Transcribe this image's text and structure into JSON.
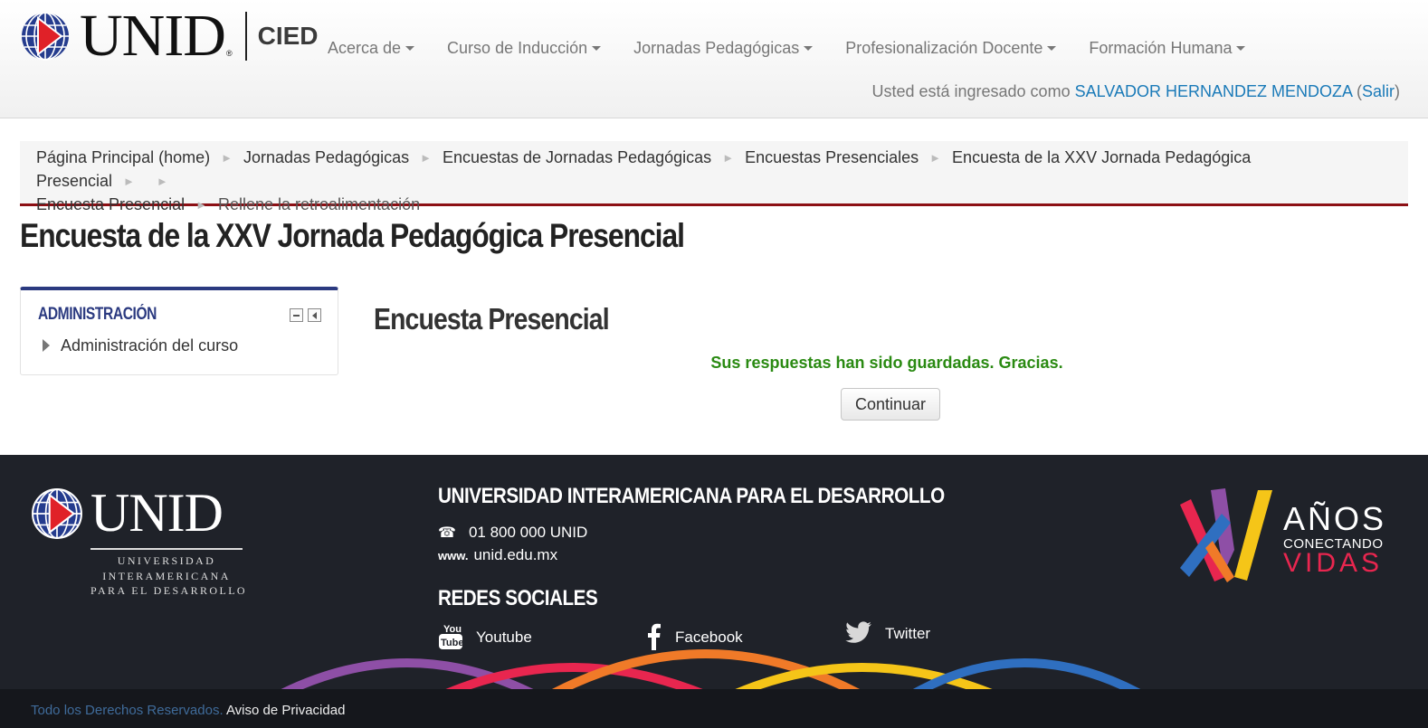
{
  "header": {
    "logo_text": "UNID",
    "logo_sub": "CIED",
    "nav": [
      {
        "label": "Acerca de"
      },
      {
        "label": "Curso de Inducción"
      },
      {
        "label": "Jornadas Pedagógicas"
      },
      {
        "label": "Profesionalización Docente"
      },
      {
        "label": "Formación Humana"
      }
    ],
    "login": {
      "prefix": "Usted está ingresado como",
      "user": "SALVADOR HERNANDEZ MENDOZA",
      "logout": "Salir"
    }
  },
  "breadcrumb": [
    "Página Principal (home)",
    "Jornadas Pedagógicas",
    "Encuestas de Jornadas Pedagógicas",
    "Encuestas Presenciales",
    "Encuesta de la XXV Jornada Pedagógica Presencial",
    "Encuesta Presencial",
    "Rellene la retroalimentación"
  ],
  "page_title": "Encuesta de la XXV Jornada Pedagógica Presencial",
  "admin_block": {
    "title": "ADMINISTRACIÓN",
    "item": "Administración del curso"
  },
  "main": {
    "section_title": "Encuesta Presencial",
    "success_message": "Sus respuestas han sido guardadas. Gracias.",
    "continue_label": "Continuar"
  },
  "footer": {
    "logo_text": "UNID",
    "logo_lines": [
      "UNIVERSIDAD",
      "INTERAMERICANA",
      "PARA EL DESARROLLO"
    ],
    "university": "UNIVERSIDAD INTERAMERICANA PARA EL DESARROLLO",
    "phone": "01 800 000 UNID",
    "web_icon": "www.",
    "web": "unid.edu.mx",
    "social_title": "REDES SOCIALES",
    "social": [
      "Youtube",
      "Facebook",
      "Twitter"
    ],
    "xv": {
      "anos": "AÑOS",
      "conectando": "CONECTANDO",
      "vidas": "VIDAS"
    },
    "rights": "Todo los Derechos Reservados.",
    "privacy": "Aviso de Privacidad"
  },
  "colors": {
    "accent_blue": "#2b3a80",
    "link_blue": "#1a7ab8",
    "breadcrumb_border": "#8c0f14",
    "success_green": "#2a8a12",
    "footer_bg": "#1f2229"
  }
}
